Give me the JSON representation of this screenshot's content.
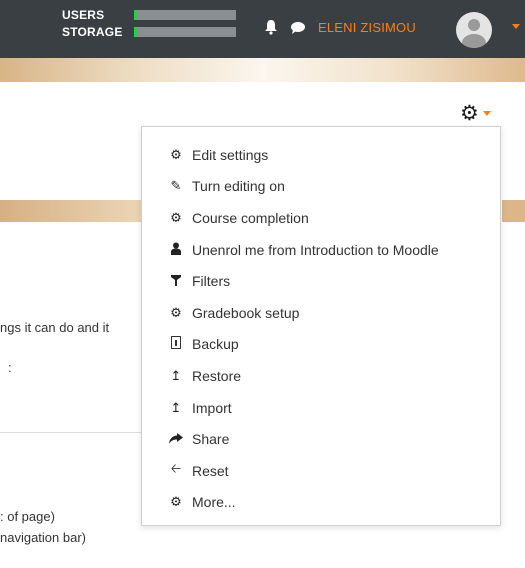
{
  "navbar": {
    "quota": [
      {
        "label": "USERS",
        "fill_fraction": 0.03
      },
      {
        "label": "STORAGE",
        "fill_fraction": 0.03
      }
    ],
    "notifications_icon": "bell-icon",
    "messages_icon": "speech-bubble-icon",
    "user_name": "ELENI ZISIMOU",
    "colors": {
      "navbar_bg": "#3a3f44",
      "accent": "#f98012",
      "quota_fill": "#2ecc40"
    }
  },
  "page": {
    "fragments": [
      "ngs it can do and it",
      ":",
      ": of page)",
      " navigation bar)"
    ]
  },
  "course_menu": {
    "trigger_icon": "gear-icon",
    "items": [
      {
        "label": "Edit settings",
        "icon": "gear-icon"
      },
      {
        "label": "Turn editing on",
        "icon": "pencil-icon"
      },
      {
        "label": "Course completion",
        "icon": "gear-icon"
      },
      {
        "label": "Unenrol me from Introduction to Moodle",
        "icon": "user-icon"
      },
      {
        "label": "Filters",
        "icon": "filter-icon"
      },
      {
        "label": "Gradebook setup",
        "icon": "gear-icon"
      },
      {
        "label": "Backup",
        "icon": "backup-file-icon"
      },
      {
        "label": "Restore",
        "icon": "upload-icon"
      },
      {
        "label": "Import",
        "icon": "upload-icon"
      },
      {
        "label": "Share",
        "icon": "share-arrow-icon"
      },
      {
        "label": "Reset",
        "icon": "arrow-left-icon"
      },
      {
        "label": "More...",
        "icon": "gear-icon"
      }
    ]
  }
}
